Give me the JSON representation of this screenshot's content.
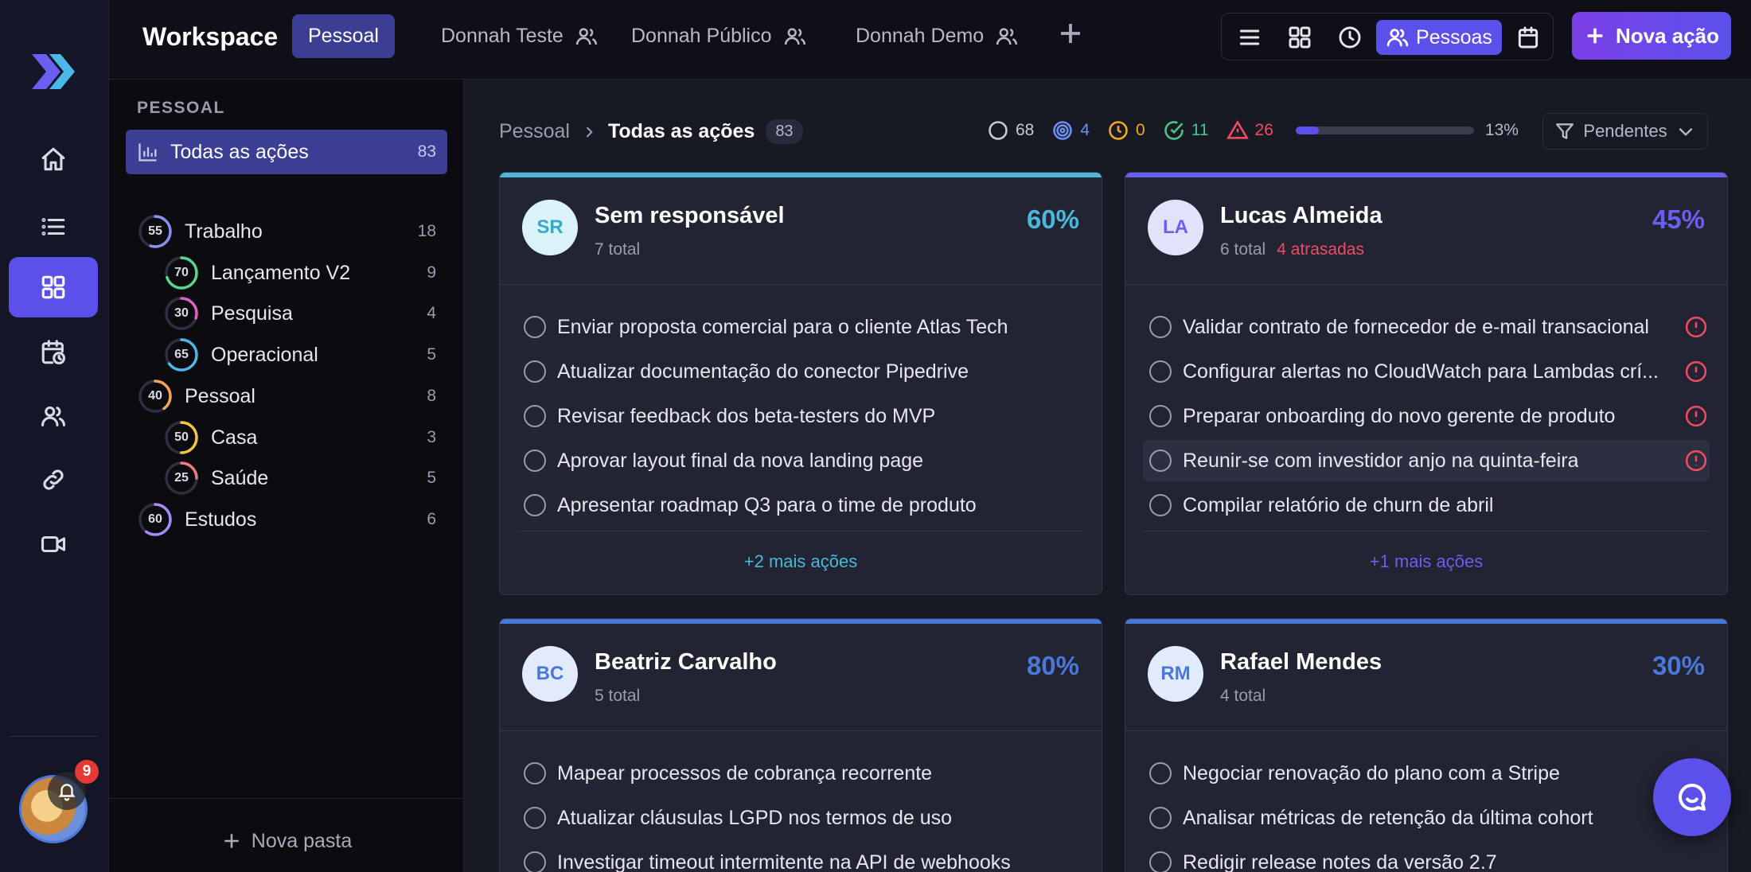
{
  "app": {
    "brand": "Workspace",
    "tabs": [
      {
        "label": "Pessoal",
        "active": true,
        "shared": false
      },
      {
        "label": "Donnah Teste",
        "active": false,
        "shared": true
      },
      {
        "label": "Donnah Público",
        "active": false,
        "shared": true
      },
      {
        "label": "Donnah Demo",
        "active": false,
        "shared": true
      }
    ],
    "people_view_label": "Pessoas",
    "new_action_label": "Nova ação",
    "notifications": "9"
  },
  "sidebar": {
    "section": "PESSOAL",
    "all": {
      "label": "Todas as ações",
      "count": "83"
    },
    "items": [
      {
        "label": "Trabalho",
        "count": "18",
        "ring": "55",
        "level": 0,
        "color": "#8b8ff0"
      },
      {
        "label": "Lançamento V2",
        "count": "9",
        "ring": "70",
        "level": 1,
        "color": "#58d68d"
      },
      {
        "label": "Pesquisa",
        "count": "4",
        "ring": "30",
        "level": 1,
        "color": "#e060c0"
      },
      {
        "label": "Operacional",
        "count": "5",
        "ring": "65",
        "level": 1,
        "color": "#4ab8e8"
      },
      {
        "label": "Pessoal",
        "count": "8",
        "ring": "40",
        "level": 0,
        "color": "#f5a45a"
      },
      {
        "label": "Casa",
        "count": "3",
        "ring": "50",
        "level": 1,
        "color": "#f5c542"
      },
      {
        "label": "Saúde",
        "count": "5",
        "ring": "25",
        "level": 1,
        "color": "#f07a8a"
      },
      {
        "label": "Estudos",
        "count": "6",
        "ring": "60",
        "level": 0,
        "color": "#a78bfa"
      }
    ],
    "new_folder": "Nova pasta"
  },
  "main": {
    "breadcrumb": {
      "root": "Pessoal",
      "current": "Todas as ações",
      "count": "83"
    },
    "stats": {
      "open": "68",
      "in_progress": "4",
      "waiting": "0",
      "done": "11",
      "late": "26",
      "progress_percent": "13%",
      "progress_value": 13
    },
    "filter_label": "Pendentes",
    "cards": [
      {
        "initials": "SR",
        "name": "Sem responsável",
        "total": "7 total",
        "late": "",
        "pct": "60%",
        "accent": "#4ab8d8",
        "avatar_bg": "#d9f3f8",
        "avatar_fg": "#3aa8c8",
        "tasks": [
          {
            "text": "Enviar proposta comercial para o cliente Atlas Tech",
            "alert": false,
            "hover": false
          },
          {
            "text": "Atualizar documentação do conector Pipedrive",
            "alert": false,
            "hover": false
          },
          {
            "text": "Revisar feedback dos beta-testers do MVP",
            "alert": false,
            "hover": false
          },
          {
            "text": "Aprovar layout final da nova landing page",
            "alert": false,
            "hover": false
          },
          {
            "text": "Apresentar roadmap Q3 para o time de produto",
            "alert": false,
            "hover": false
          }
        ],
        "more": "+2 mais ações"
      },
      {
        "initials": "LA",
        "name": "Lucas Almeida",
        "total": "6 total",
        "late": "4 atrasadas",
        "pct": "45%",
        "accent": "#6a5ff0",
        "avatar_bg": "#e3e2fb",
        "avatar_fg": "#6a5ff0",
        "tasks": [
          {
            "text": "Validar contrato de fornecedor de e-mail transacional",
            "alert": true,
            "hover": false
          },
          {
            "text": "Configurar alertas no CloudWatch para Lambdas crí...",
            "alert": true,
            "hover": false
          },
          {
            "text": "Preparar onboarding do novo gerente de produto",
            "alert": true,
            "hover": false
          },
          {
            "text": "Reunir-se com investidor anjo na quinta-feira",
            "alert": true,
            "hover": true
          },
          {
            "text": "Compilar relatório de churn de abril",
            "alert": false,
            "hover": false
          }
        ],
        "more": "+1 mais ações"
      },
      {
        "initials": "BC",
        "name": "Beatriz Carvalho",
        "total": "5 total",
        "late": "",
        "pct": "80%",
        "accent": "#4a78d8",
        "avatar_bg": "#e2ebfb",
        "avatar_fg": "#4a78d8",
        "tasks": [
          {
            "text": "Mapear processos de cobrança recorrente",
            "alert": false,
            "hover": false
          },
          {
            "text": "Atualizar cláusulas LGPD nos termos de uso",
            "alert": false,
            "hover": false
          },
          {
            "text": "Investigar timeout intermitente na API de webhooks",
            "alert": false,
            "hover": false
          }
        ],
        "more": ""
      },
      {
        "initials": "RM",
        "name": "Rafael Mendes",
        "total": "4 total",
        "late": "",
        "pct": "30%",
        "accent": "#4a78d8",
        "avatar_bg": "#e2ebfb",
        "avatar_fg": "#4a78d8",
        "tasks": [
          {
            "text": "Negociar renovação do plano com a Stripe",
            "alert": false,
            "hover": false
          },
          {
            "text": "Analisar métricas de retenção da última cohort",
            "alert": false,
            "hover": false
          },
          {
            "text": "Redigir release notes da versão 2.7",
            "alert": false,
            "hover": false
          }
        ],
        "more": ""
      }
    ]
  }
}
